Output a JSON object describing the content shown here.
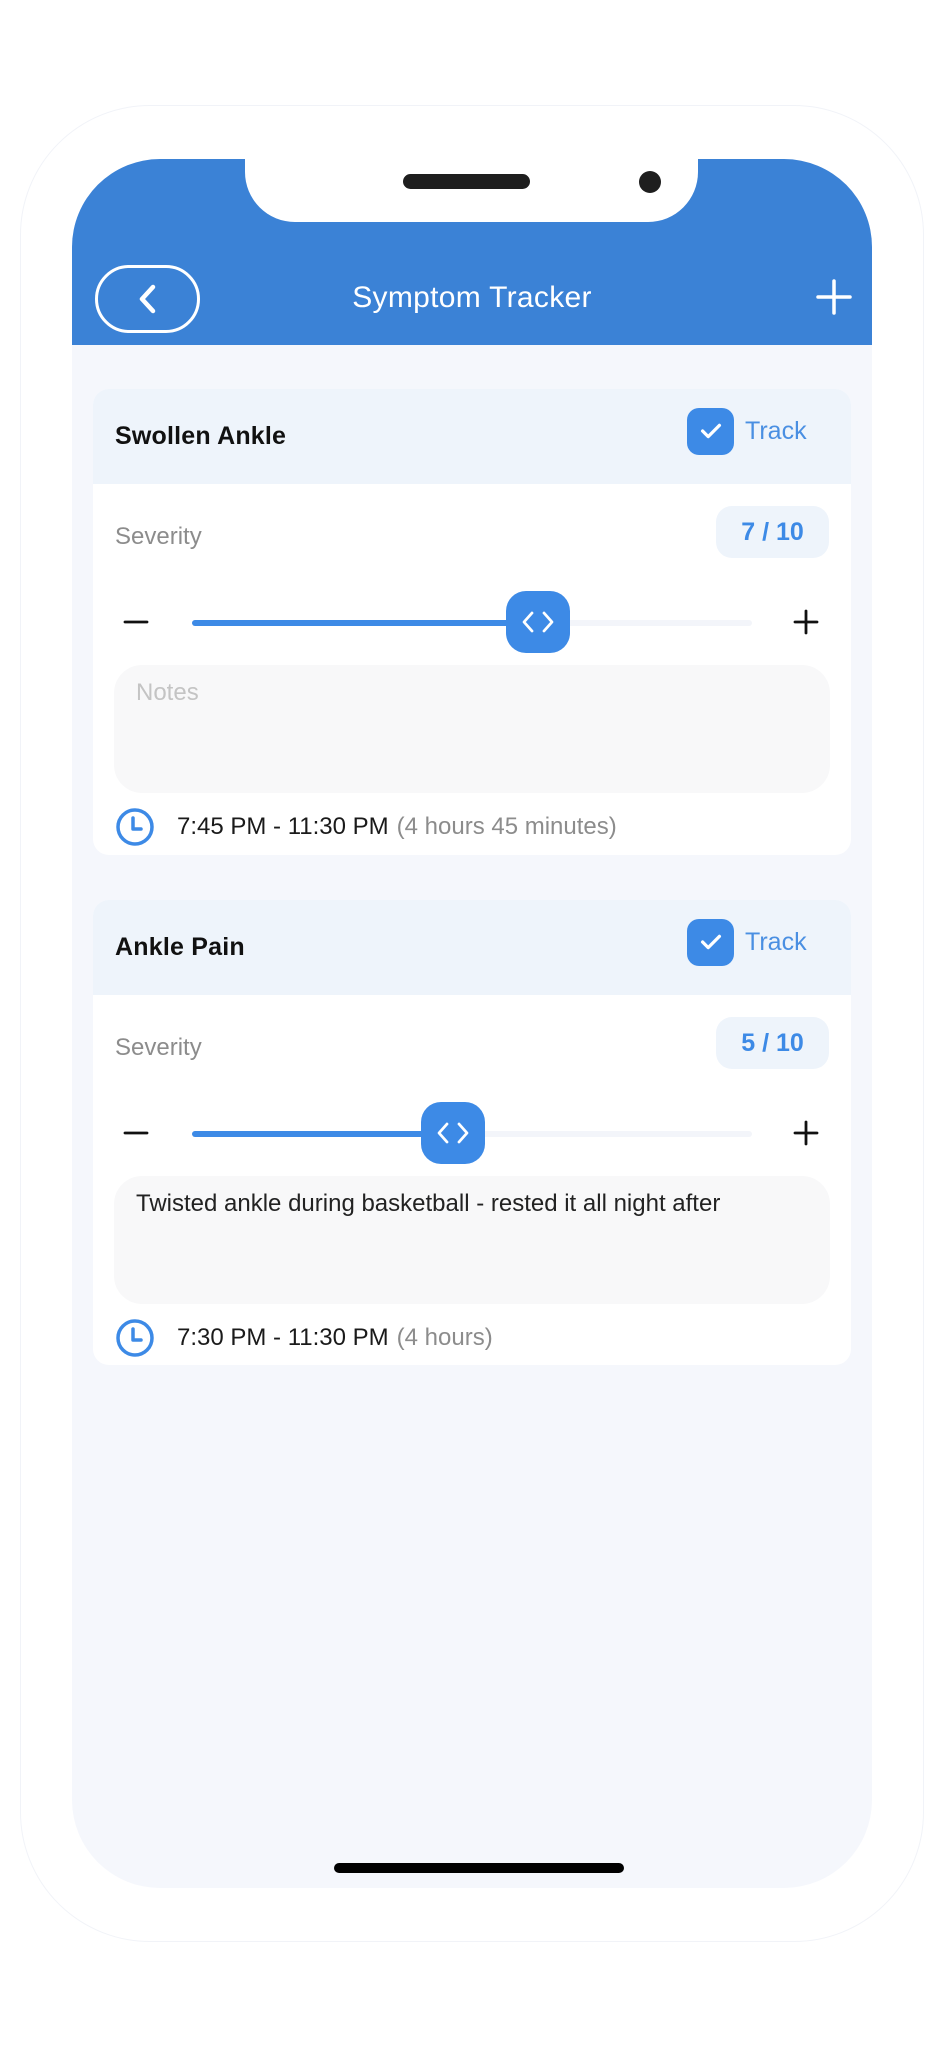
{
  "header": {
    "title": "Symptom Tracker",
    "back_icon": "chevron-left-icon",
    "add_icon": "plus-icon",
    "color": "#3b82d6"
  },
  "accent_color": "#3d8ae6",
  "symptoms": [
    {
      "name": "Swollen Ankle",
      "track_label": "Track",
      "tracked": true,
      "severity_label": "Severity",
      "severity_value": 7,
      "severity_max": 10,
      "severity_text": "7 / 10",
      "notes_placeholder": "Notes",
      "notes": "",
      "time_range": "7:45 PM - 11:30 PM",
      "duration": "(4 hours 45 minutes)"
    },
    {
      "name": "Ankle Pain",
      "track_label": "Track",
      "tracked": true,
      "severity_label": "Severity",
      "severity_value": 5,
      "severity_max": 10,
      "severity_text": "5 / 10",
      "notes_placeholder": "Notes",
      "notes": "Twisted ankle during basketball - rested it all night after",
      "time_range": "7:30 PM - 11:30 PM",
      "duration": "(4 hours)"
    }
  ]
}
